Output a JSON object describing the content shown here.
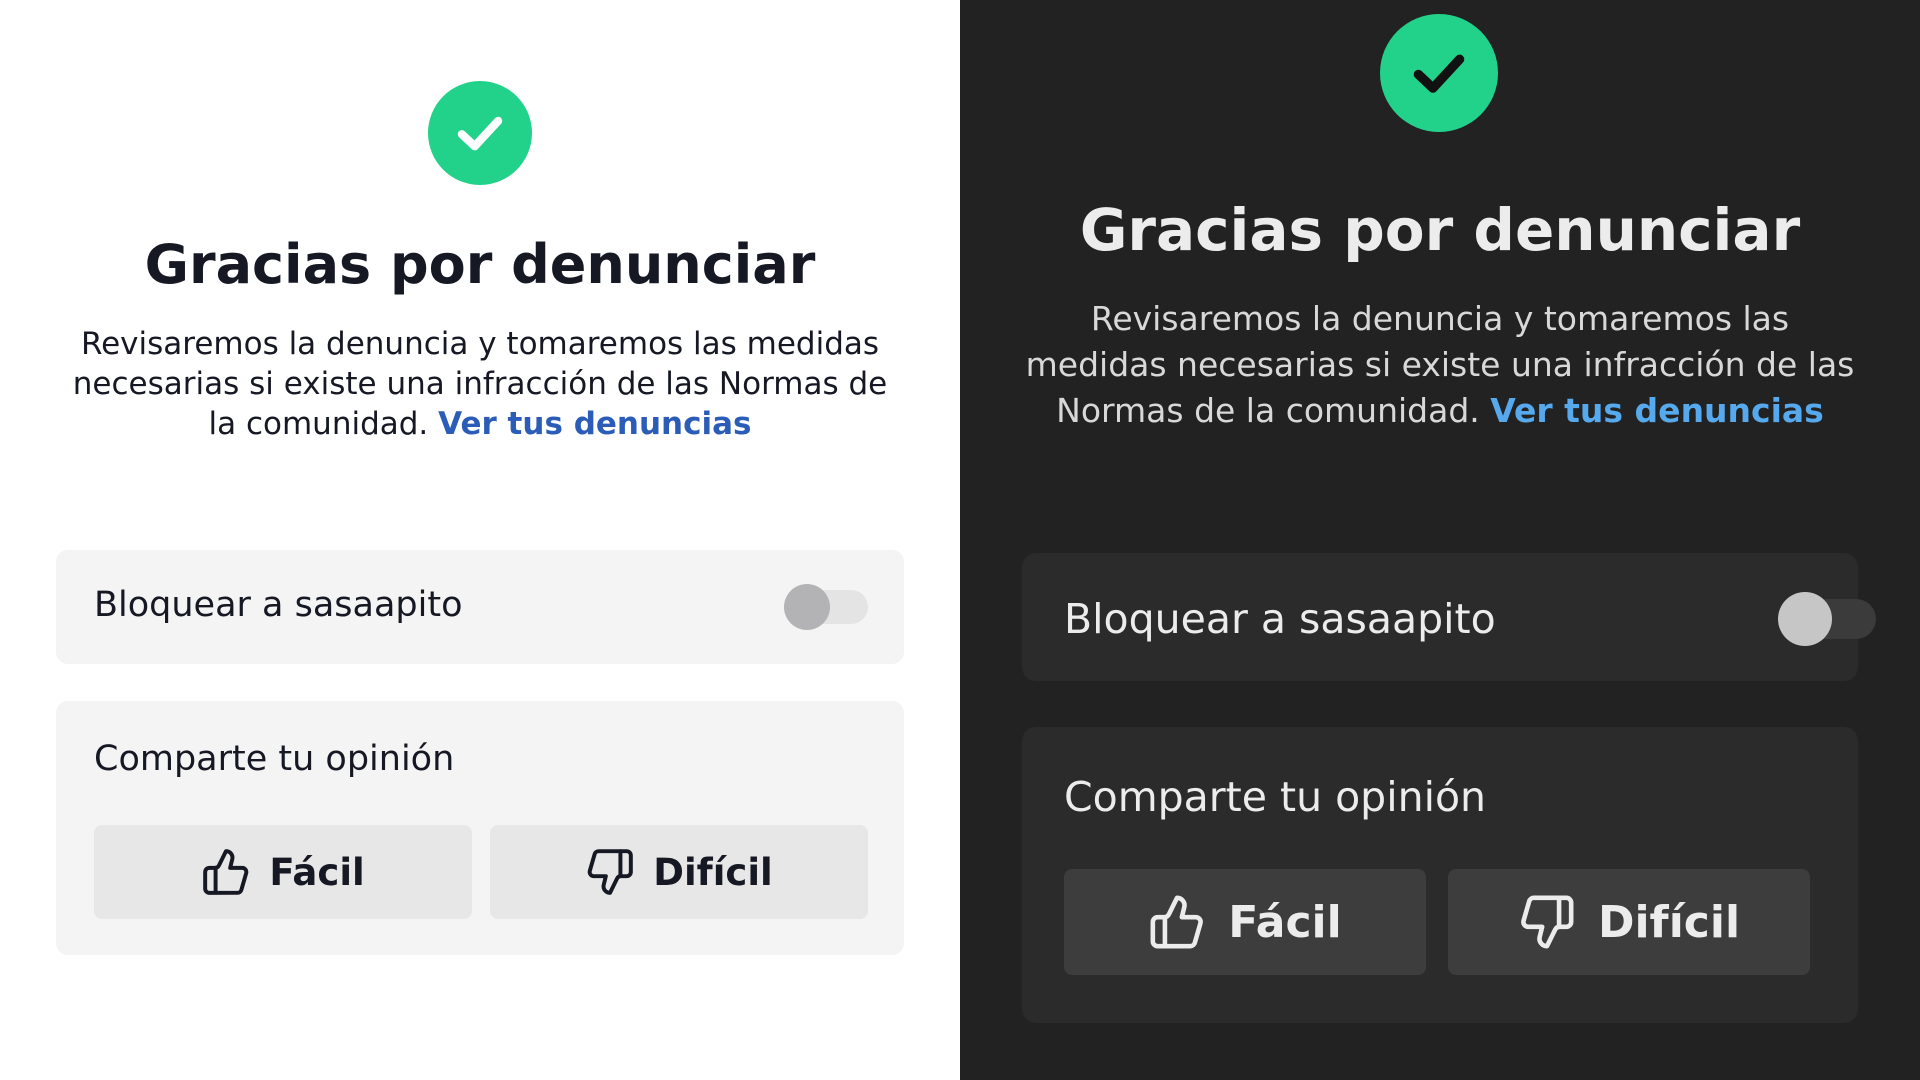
{
  "panels": {
    "light": {
      "theme": "light",
      "title": "Gracias por denunciar",
      "description": "Revisaremos la denuncia y tomaremos las medidas necesarias si existe una infracción de las Normas de la comunidad.",
      "link": "Ver tus denuncias",
      "block_label": "Bloquear a sasaapito",
      "block_enabled": false,
      "opinion_label": "Comparte tu opinión",
      "easy_label": "Fácil",
      "hard_label": "Difícil"
    },
    "dark": {
      "theme": "dark",
      "title": "Gracias por denunciar",
      "description": "Revisaremos la denuncia y tomaremos las medidas necesarias si existe una infracción de las Normas de la comunidad.",
      "link": "Ver tus denuncias",
      "block_label": "Bloquear a sasaapito",
      "block_enabled": false,
      "opinion_label": "Comparte tu opinión",
      "easy_label": "Fácil",
      "hard_label": "Difícil"
    }
  },
  "icons": {
    "success": "check-circle-icon",
    "easy": "thumbs-up-icon",
    "hard": "thumbs-down-icon"
  },
  "colors": {
    "success_green": "#22d28a",
    "link_light": "#2b5db8",
    "link_dark": "#57a9ee",
    "background_light": "#ffffff",
    "background_dark": "#222222"
  }
}
